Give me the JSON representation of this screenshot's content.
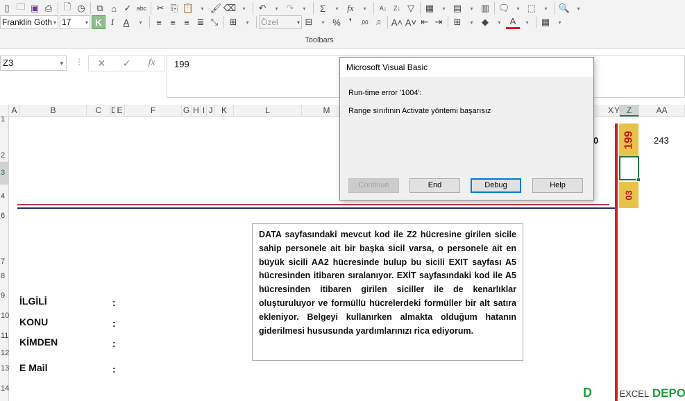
{
  "toolbar": {
    "font_name": "Franklin Goth",
    "font_size": "17",
    "bold_label": "K",
    "italic_label": "I",
    "underline_label": "A",
    "number_format": "Özel",
    "percent_label": "%",
    "caption": "Toolbars"
  },
  "formula_bar": {
    "name_box": "Z3",
    "fx_label": "fx",
    "value": "199"
  },
  "columns": [
    "A",
    "B",
    "C",
    "D",
    "E",
    "F",
    "G",
    "H",
    "I",
    "J",
    "K",
    "L",
    "M",
    "X",
    "Y",
    "Z",
    "AA"
  ],
  "rows": [
    "1",
    "2",
    "3",
    "4",
    "6",
    "7",
    "8",
    "9",
    "10",
    "11",
    "12",
    "13",
    "14"
  ],
  "sheet": {
    "labels": [
      "İLGİLİ",
      "KONU",
      "KİMDEN",
      "E Mail"
    ],
    "colon": ":",
    "note": "DATA sayfasındaki mevcut kod ile Z2 hücresine girilen sicile sahip personele ait bir başka sicil varsa, o personele ait en büyük sicili AA2 hücresinde bulup bu sicili EXIT sayfası A5 hücresinden itibaren sıralanıyor. EXİT sayfasındaki kod ile A5 hücresinden itibaren girilen siciller ile de kenarlıklar oluşturuluyor ve formüllü hücrelerdeki formüller bir alt satıra ekleniyor. Belgeyi kullanırken almakta olduğum hatanın giderilmesi hususunda yardımlarınızı rica ediyorum.",
    "x2_value": "0",
    "z2_value": "199",
    "aa2_value": "243",
    "z4_value": "03"
  },
  "dialog": {
    "title": "Microsoft Visual Basic",
    "error": "Run-time error '1004':",
    "message": "Range sınıfının Activate yöntemi başarısız",
    "buttons": [
      "Continue",
      "End",
      "Debug",
      "Help"
    ]
  },
  "watermark": {
    "left": "D",
    "mid": "EXCEL",
    "right": "DEPO"
  },
  "colors": {
    "accent": "#217346",
    "red": "#d62020",
    "yellow": "#e8c34a",
    "navy": "#1f2a6b"
  }
}
